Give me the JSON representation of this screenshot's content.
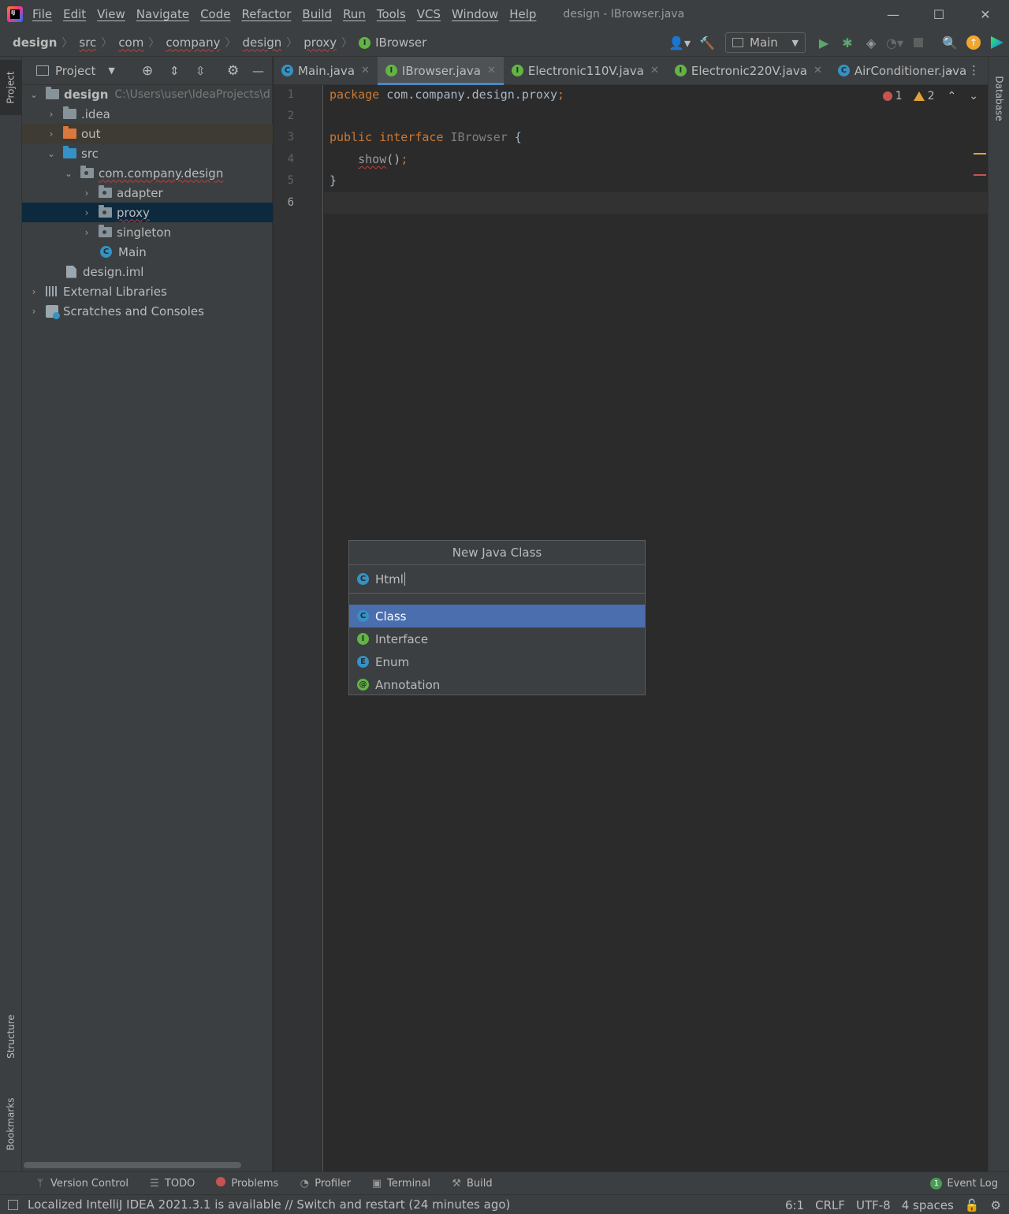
{
  "menu": {
    "items": [
      "File",
      "Edit",
      "View",
      "Navigate",
      "Code",
      "Refactor",
      "Build",
      "Run",
      "Tools",
      "VCS",
      "Window",
      "Help"
    ],
    "window_title": "design - IBrowser.java",
    "logo_text": "IJ"
  },
  "window_controls": {
    "minimize": "—",
    "maximize": "☐",
    "close": "✕"
  },
  "breadcrumbs": [
    "design",
    "src",
    "com",
    "company",
    "design",
    "proxy",
    "IBrowser"
  ],
  "toolbar": {
    "run_config": "Main"
  },
  "project_panel": {
    "title": "Project",
    "tree": [
      {
        "label": "design",
        "hint": "C:\\Users\\user\\IdeaProjects\\d"
      },
      {
        "label": ".idea"
      },
      {
        "label": "out"
      },
      {
        "label": "src"
      },
      {
        "label": "com.company.design"
      },
      {
        "label": "adapter"
      },
      {
        "label": "proxy"
      },
      {
        "label": "singleton"
      },
      {
        "label": "Main"
      },
      {
        "label": "design.iml"
      },
      {
        "label": "External Libraries"
      },
      {
        "label": "Scratches and Consoles"
      }
    ]
  },
  "side_tabs": {
    "project": "Project",
    "structure": "Structure",
    "bookmarks": "Bookmarks",
    "database": "Database"
  },
  "editor_tabs": [
    {
      "label": "Main.java",
      "icon": "class-icon"
    },
    {
      "label": "IBrowser.java",
      "icon": "interface-icon"
    },
    {
      "label": "Electronic110V.java",
      "icon": "interface-icon"
    },
    {
      "label": "Electronic220V.java",
      "icon": "interface-icon"
    },
    {
      "label": "AirConditioner.java",
      "icon": "class-icon"
    }
  ],
  "code": {
    "line_numbers": [
      "1",
      "2",
      "3",
      "4",
      "5",
      "6"
    ],
    "line1_kw": "package",
    "line1_rest": " com.company.design.proxy",
    "line1_semi": ";",
    "line3_kw1": "public",
    "line3_kw2": "interface",
    "line3_name": "IBrowser",
    "line3_brace": " {",
    "line4_method": "show",
    "line4_rest": "()",
    "line4_semi": ";",
    "line5": "}"
  },
  "inspections": {
    "errors": "1",
    "warnings": "2"
  },
  "popup": {
    "title": "New Java Class",
    "input_value": "Html",
    "items": [
      {
        "label": "Class",
        "badge": "C"
      },
      {
        "label": "Interface",
        "badge": "I"
      },
      {
        "label": "Enum",
        "badge": "E"
      },
      {
        "label": "Annotation",
        "badge": "@"
      }
    ]
  },
  "bottom_tools": [
    "Version Control",
    "TODO",
    "Problems",
    "Profiler",
    "Terminal",
    "Build"
  ],
  "event_log": {
    "label": "Event Log",
    "count": "1"
  },
  "status": {
    "message": "Localized IntelliJ IDEA 2021.3.1 is available // Switch and restart (24 minutes ago)",
    "position": "6:1",
    "line_sep": "CRLF",
    "encoding": "UTF-8",
    "indent": "4 spaces"
  },
  "colors": {
    "keyword": "#cc7832",
    "selection": "#4b6eaf",
    "tree_selection": "#0d293e",
    "interface_badge": "#62b543",
    "class_badge": "#3592c4"
  }
}
